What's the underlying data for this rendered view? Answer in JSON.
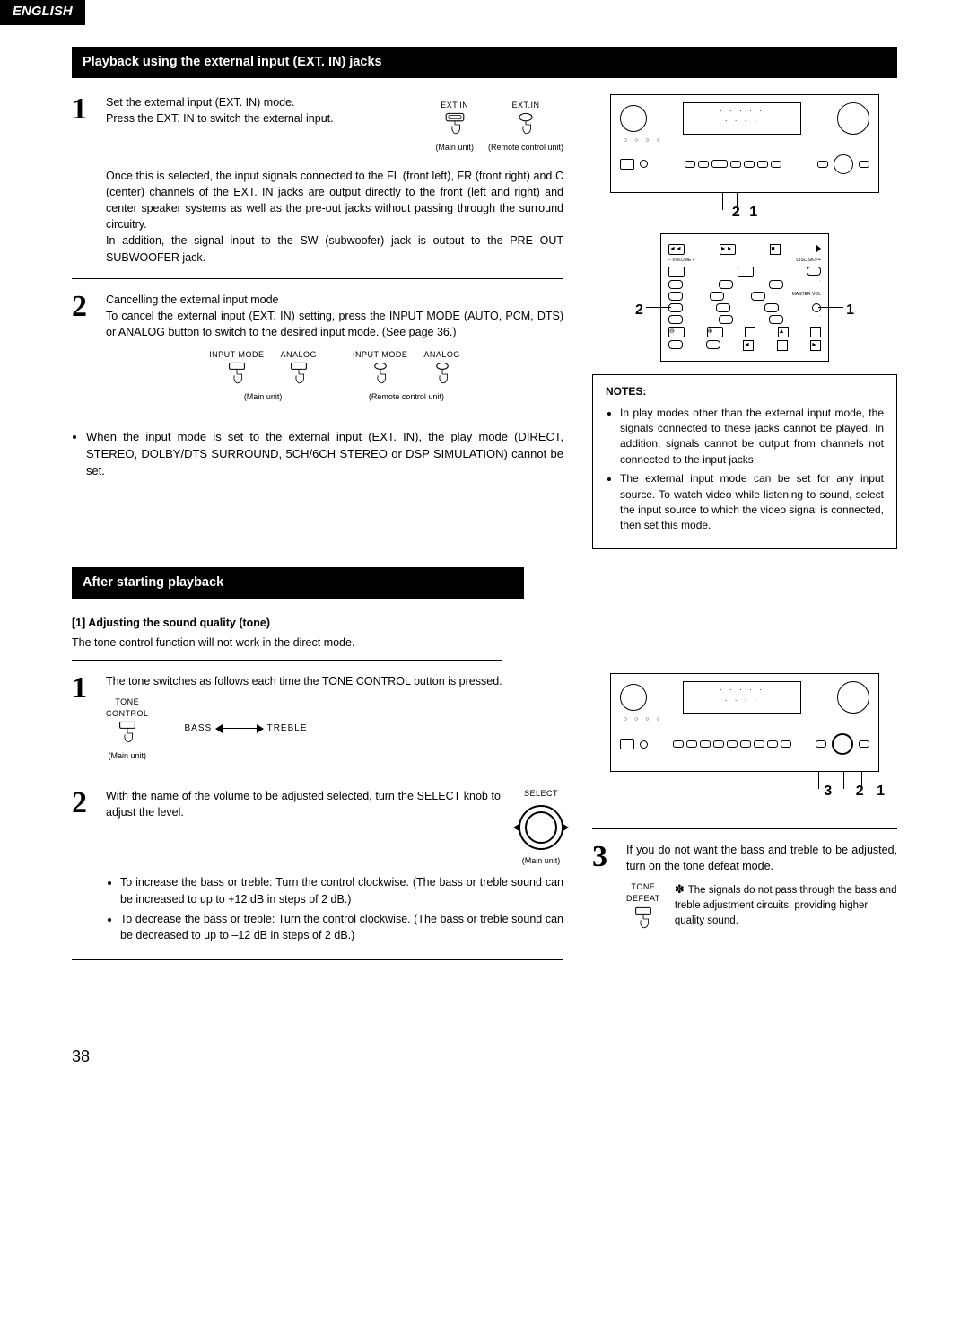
{
  "language_tab": "ENGLISH",
  "page_number": "38",
  "section1": {
    "title": "Playback using the external input (EXT. IN) jacks",
    "step1": {
      "num": "1",
      "line1": "Set the external input (EXT. IN) mode.",
      "line2": "Press the EXT. IN to switch the external input.",
      "label_main": "(Main unit)",
      "label_remote": "(Remote control unit)",
      "btn_label": "EXT.IN",
      "para": "Once this is selected, the input signals connected to the FL (front left), FR (front right) and C (center) channels of the EXT. IN jacks are output directly to the front (left and right) and center speaker systems as well as the pre-out jacks without passing through the surround circuitry.",
      "para2": "In addition, the signal input to the SW (subwoofer) jack is output to the PRE OUT SUBWOOFER jack."
    },
    "step2": {
      "num": "2",
      "line1": "Cancelling the external input mode",
      "line2": "To cancel the external input (EXT. IN) setting, press the INPUT MODE (AUTO, PCM, DTS) or ANALOG button to switch to the desired input mode. (See page 36.)",
      "lbl_input_mode": "INPUT MODE",
      "lbl_analog": "ANALOG",
      "label_main": "(Main unit)",
      "label_remote": "(Remote control unit)",
      "bullet1": "When the input mode is set to the external input (EXT. IN), the play mode (DIRECT, STEREO, DOLBY/DTS SURROUND, 5CH/6CH STEREO or DSP SIMULATION) cannot be set."
    },
    "diagram": {
      "callout1": "1",
      "callout2": "2"
    },
    "notes": {
      "title": "NOTES:",
      "n1": "In play modes other than the external input mode, the signals connected to these jacks cannot be played. In addition, signals cannot be output from channels not connected to the input jacks.",
      "n2": "The external input mode can be set for any input source. To watch video while listening to sound, select the input source to which the video signal is connected, then set this mode."
    }
  },
  "section2": {
    "title": "After starting playback",
    "subtitle": "[1] Adjusting the sound quality (tone)",
    "intro": "The tone control function will not work in the direct mode.",
    "step1": {
      "num": "1",
      "text": "The tone switches as follows each time the TONE CONTROL button is pressed.",
      "tone_control_label": "TONE\nCONTROL",
      "bass": "BASS",
      "treble": "TREBLE",
      "label_main": "(Main unit)"
    },
    "step2": {
      "num": "2",
      "text": "With the name of the volume to be adjusted selected, turn the SELECT knob to adjust the level.",
      "select_label": "SELECT",
      "label_main": "(Main unit)",
      "b1": "To increase the bass or treble: Turn the control clockwise. (The bass or treble sound can be increased to up to +12 dB in steps of 2 dB.)",
      "b2": "To decrease the bass or treble: Turn the control clockwise. (The bass or treble sound can be decreased to up to –12 dB in steps of 2 dB.)"
    },
    "diagram": {
      "c1": "1",
      "c2": "2",
      "c3": "3"
    },
    "step3": {
      "num": "3",
      "text": "If you do not want the bass and treble to be adjusted, turn on the tone defeat mode.",
      "tone_defeat": "TONE DEFEAT",
      "signote": "The signals do not pass through the bass and treble adjustment circuits, providing higher quality sound.",
      "ast": "✽"
    }
  }
}
